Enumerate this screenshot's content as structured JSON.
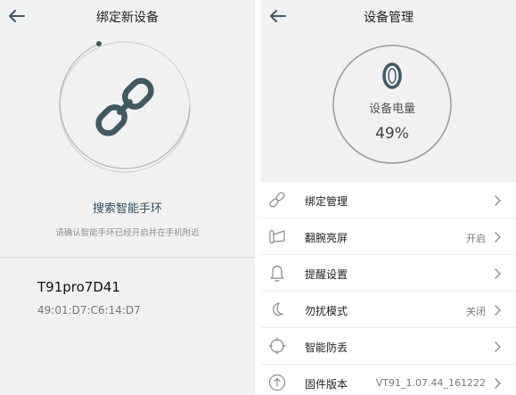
{
  "left_screen": {
    "title": "绑定新设备",
    "search_title": "搜索智能手环",
    "search_hint": "请确认智能手环已经开启并在手机附近",
    "device": {
      "name": "T91pro7D41",
      "mac": "49:01:D7:C6:14:D7"
    }
  },
  "right_screen": {
    "title": "设备管理",
    "battery": {
      "label": "设备电量",
      "value": "49%"
    },
    "menu": [
      {
        "label": "绑定管理",
        "value": "",
        "icon": "link-icon"
      },
      {
        "label": "翻腕亮屏",
        "value": "开启",
        "icon": "wrist-icon"
      },
      {
        "label": "提醒设置",
        "value": "",
        "icon": "bell-icon"
      },
      {
        "label": "勿扰模式",
        "value": "关闭",
        "icon": "moon-icon"
      },
      {
        "label": "智能防丢",
        "value": "",
        "icon": "target-icon"
      },
      {
        "label": "固件版本",
        "value": "VT91_1.07.44_161222",
        "icon": "upload-icon"
      }
    ]
  },
  "colors": {
    "accent_dark": "#3f5965",
    "background": "#f1f1f1",
    "ring": "#c8c8c8"
  }
}
